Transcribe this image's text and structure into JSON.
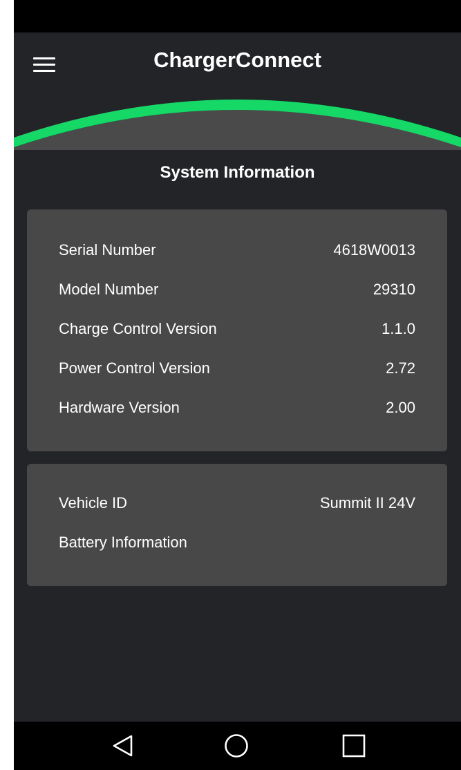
{
  "app": {
    "title": "ChargerConnect"
  },
  "page": {
    "section_title": "System Information"
  },
  "system_info": [
    {
      "label": "Serial Number",
      "value": "4618W0013"
    },
    {
      "label": "Model Number",
      "value": "29310"
    },
    {
      "label": "Charge Control Version",
      "value": "1.1.0"
    },
    {
      "label": "Power Control Version",
      "value": "2.72"
    },
    {
      "label": "Hardware Version",
      "value": "2.00"
    }
  ],
  "vehicle_info": [
    {
      "label": "Vehicle ID",
      "value": "Summit II 24V"
    },
    {
      "label": "Battery Information",
      "value": ""
    }
  ],
  "icons": {
    "menu": "hamburger-menu-icon",
    "back": "back-triangle-icon",
    "home": "home-circle-icon",
    "recents": "recents-square-icon"
  },
  "colors": {
    "accent": "#15d866",
    "background": "#232428",
    "card": "#484849",
    "text": "#ffffff"
  }
}
